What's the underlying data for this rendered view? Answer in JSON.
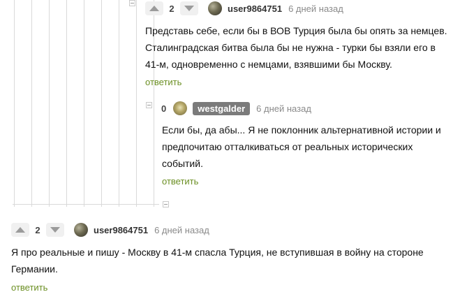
{
  "comments": [
    {
      "vote_score": "2",
      "username": "user9864751",
      "time": "6 дней назад",
      "text_lines": [
        "Представь себе, если бы в ВОВ Турция была бы опять за немцев.",
        "Сталинградская битва была бы не нужна - турки бы взяли его в",
        "41-м, одновременно с немцами, взявшими бы Москву."
      ],
      "reply_label": "ответить"
    },
    {
      "vote_score": "0",
      "username": "westgalder",
      "time": "6 дней назад",
      "text_lines": [
        "Если бы, да абы... Я не поклонник альтернативной истории и",
        "предпочитаю отталкиваться от реальных исторических",
        "событий."
      ],
      "reply_label": "ответить"
    },
    {
      "vote_score": "2",
      "username": "user9864751",
      "time": "6 дней назад",
      "text_lines": [
        "Я про реальные и пишу - Москву в 41-м спасла Турция, не вступившая в войну на стороне",
        "Германии."
      ],
      "reply_label": "ответить"
    }
  ]
}
